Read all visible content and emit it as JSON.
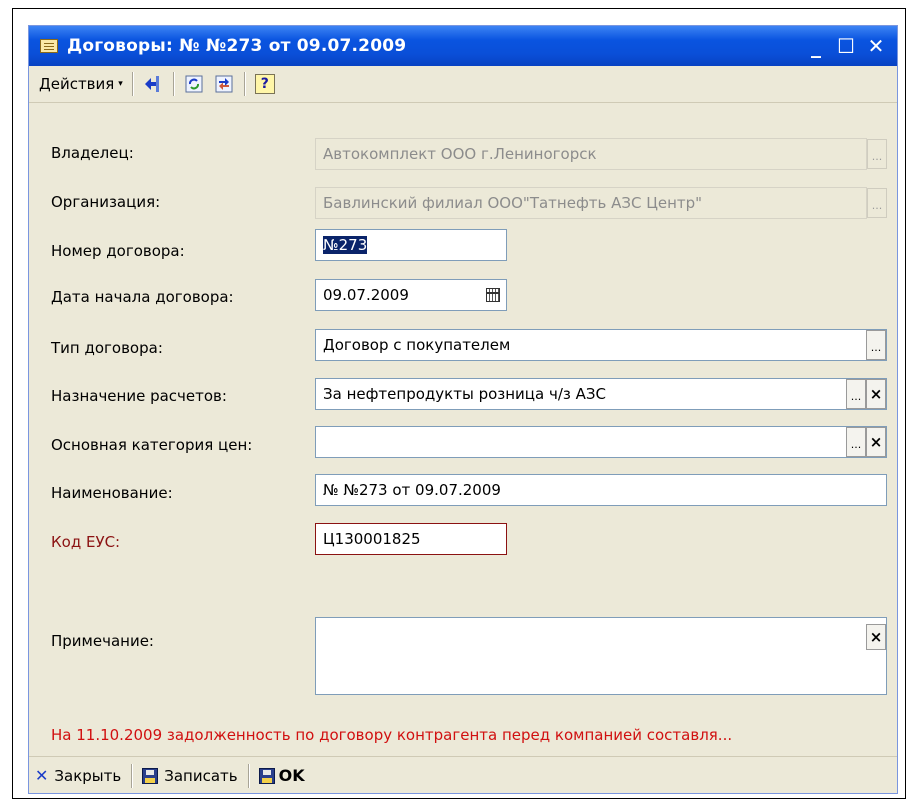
{
  "window": {
    "title": "Договоры: № №273 от 09.07.2009",
    "controls": [
      "_",
      "☐",
      "✕"
    ]
  },
  "toolbar": {
    "actions_label": "Действия",
    "actions_arrow": "▾",
    "icons": [
      "arrow-left-icon",
      "refresh-icon",
      "switch-icon",
      "help-icon"
    ],
    "help_glyph": "?"
  },
  "form": {
    "owner": {
      "label": "Владелец:",
      "value": "Автокомплект ООО г.Лениногорск"
    },
    "organization": {
      "label": "Организация:",
      "value": "Бавлинский филиал ООО\"Татнефть АЗС Центр\""
    },
    "contract_number": {
      "label": "Номер договора:",
      "value": "№273"
    },
    "start_date": {
      "label": "Дата начала договора:",
      "value": "09.07.2009"
    },
    "contract_type": {
      "label": "Тип договора:",
      "value": "Договор с покупателем"
    },
    "settlement_purpose": {
      "label": "Назначение расчетов:",
      "value": "За нефтепродукты розница ч/з АЗС"
    },
    "price_category": {
      "label": "Основная категория цен:",
      "value": ""
    },
    "name": {
      "label": "Наименование:",
      "value": "№ №273 от 09.07.2009"
    },
    "eus_code": {
      "label": "Код ЕУС:",
      "value": "Ц130001825"
    },
    "note": {
      "label": "Примечание:",
      "value": ""
    },
    "dots": "...",
    "clear": "×"
  },
  "warning": "На 11.10.2009 задолженность по договору контрагента перед компанией составля...",
  "bottom": {
    "close_label": "Закрыть",
    "save_label": "Записать",
    "ok_label": "OK"
  },
  "colors": {
    "title_bar": "#0a54e0",
    "window_bg": "#ece9d8",
    "required_label": "#8b1212",
    "warning": "#d11010",
    "selection": "#0a246a"
  }
}
